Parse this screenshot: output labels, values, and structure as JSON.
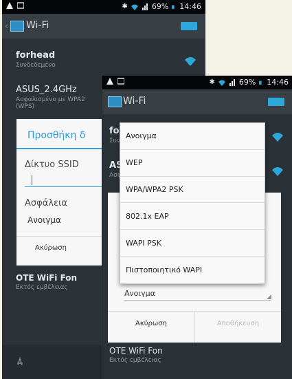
{
  "back_screen": {
    "statusbar": {
      "battery": "69%",
      "time": "14:46"
    },
    "title": "Wi-Fi",
    "networks": [
      {
        "name": "forhead",
        "status": "Συνδεδεμένο"
      },
      {
        "name": "ASUS_2.4GHz",
        "status": "Ασφαλισμένο με WPA2 (WPS)"
      },
      {
        "name": "OTE WiFi Fon",
        "status": "Εκτός εμβέλειας"
      }
    ],
    "dialog": {
      "title": "Προσθήκη δ",
      "ssid_label": "Δίκτυο SSID",
      "ssid_value": "",
      "security_label": "Ασφάλεια",
      "security_value": "Ανοιγμα",
      "cancel": "Ακύρωση"
    }
  },
  "front_screen": {
    "statusbar": {
      "battery": "69%",
      "time": "14:46"
    },
    "title": "Wi-Fi",
    "network_partial": [
      {
        "name": "for",
        "status": "Συν"
      },
      {
        "name": "AS",
        "status": "Ασφ"
      }
    ],
    "dialog": {
      "security_value": "Ανοιγμα",
      "cancel": "Ακύρωση",
      "save": "Αποθήκευση"
    },
    "bottom_network": {
      "name": "OTE WiFi Fon",
      "status": "Εκτός εμβέλειας"
    },
    "security_options": [
      "Ανοιγμα",
      "WEP",
      "WPA/WPA2 PSK",
      "802.1x EAP",
      "WAPI PSK",
      "Πιστοποιητικό WAPI"
    ]
  },
  "colors": {
    "accent": "#31a8e0",
    "status_bar": "#050607",
    "background": "#2c3338"
  }
}
